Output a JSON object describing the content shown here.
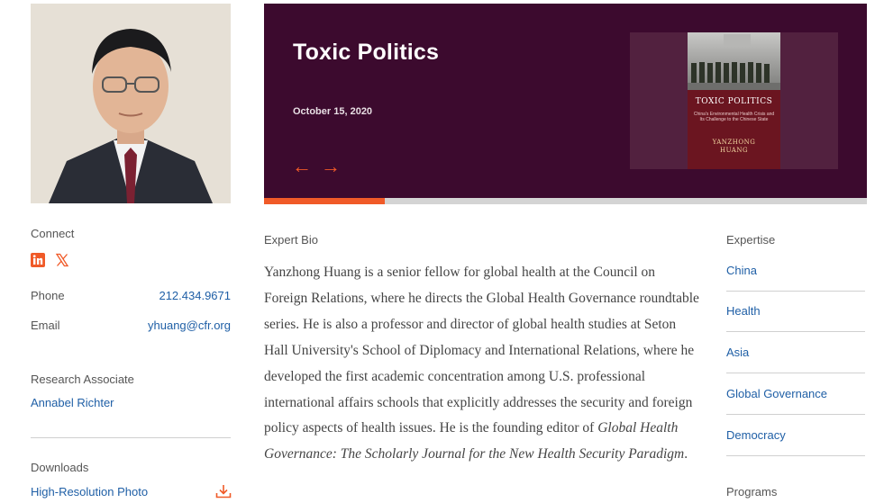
{
  "profile": {
    "photo_alt": ""
  },
  "connect": {
    "heading": "Connect",
    "icons": [
      "linkedin-icon",
      "x-twitter-icon"
    ],
    "phone_label": "Phone",
    "phone_value": "212.434.9671",
    "email_label": "Email",
    "email_value": "yhuang@cfr.org"
  },
  "research": {
    "heading": "Research Associate",
    "name": "Annabel Richter"
  },
  "downloads": {
    "heading": "Downloads",
    "item": "High-Resolution Photo"
  },
  "hero": {
    "title": "Toxic Politics",
    "date": "October 15, 2020",
    "prev_arrow": "←",
    "next_arrow": "→",
    "progress": 0.2,
    "book": {
      "title": "TOXIC POLITICS",
      "subtitle": "China's Environmental Health Crisis and Its Challenge to the Chinese State",
      "author_first": "YANZHONG",
      "author_last": "HUANG"
    }
  },
  "bio": {
    "heading": "Expert Bio",
    "text_plain": "Yanzhong Huang is a senior fellow for global health at the Council on Foreign Relations, where he directs the Global Health Governance roundtable series. He is also a professor and director of global health studies at Seton Hall University's School of Diplomacy and International Relations, where he developed the first academic concentration among U.S. professional international affairs schools that explicitly addresses the security and foreign policy aspects of health issues. He is the founding editor of ",
    "text_italic": "Global Health Governance: The Scholarly Journal for the New Health Security Paradigm",
    "text_end": "."
  },
  "expertise": {
    "heading": "Expertise",
    "items": [
      "China",
      "Health",
      "Asia",
      "Global Governance",
      "Democracy"
    ]
  },
  "programs": {
    "heading": "Programs"
  },
  "colors": {
    "hero_bg": "#3c0a2e",
    "accent_orange": "#f05a28",
    "link_blue": "#1f5fa6"
  }
}
